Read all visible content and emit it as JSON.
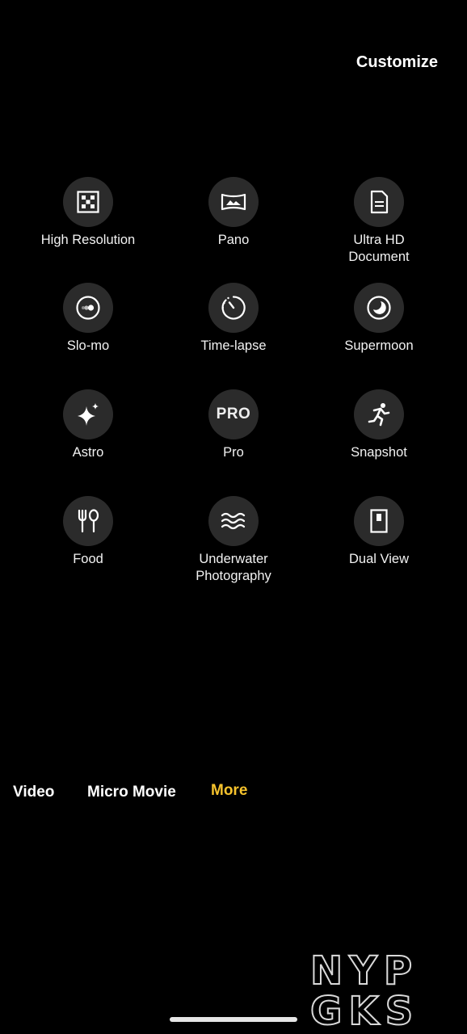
{
  "header": {
    "customize_label": "Customize"
  },
  "modes": [
    {
      "label": "High Resolution",
      "icon": "high-resolution-icon"
    },
    {
      "label": "Pano",
      "icon": "panorama-icon"
    },
    {
      "label": "Ultra HD\nDocument",
      "icon": "document-icon"
    },
    {
      "label": "Slo-mo",
      "icon": "slo-mo-icon"
    },
    {
      "label": "Time-lapse",
      "icon": "time-lapse-icon"
    },
    {
      "label": "Supermoon",
      "icon": "moon-icon"
    },
    {
      "label": "Astro",
      "icon": "sparkle-icon"
    },
    {
      "label": "Pro",
      "icon": "pro-icon",
      "icon_text": "PRO"
    },
    {
      "label": "Snapshot",
      "icon": "running-person-icon"
    },
    {
      "label": "Food",
      "icon": "fork-spoon-icon"
    },
    {
      "label": "Underwater\nPhotography",
      "icon": "waves-icon"
    },
    {
      "label": "Dual View",
      "icon": "dual-view-icon"
    }
  ],
  "mode_bar": {
    "tabs": [
      {
        "label": "Video"
      },
      {
        "label": "Micro Movie"
      },
      {
        "label": "More",
        "active": true
      }
    ]
  },
  "watermark": {
    "line1": "NYP",
    "line2": "GKS"
  },
  "colors": {
    "background": "#000000",
    "icon_circle": "#2b2b2b",
    "active_tab": "#f6c32d"
  }
}
